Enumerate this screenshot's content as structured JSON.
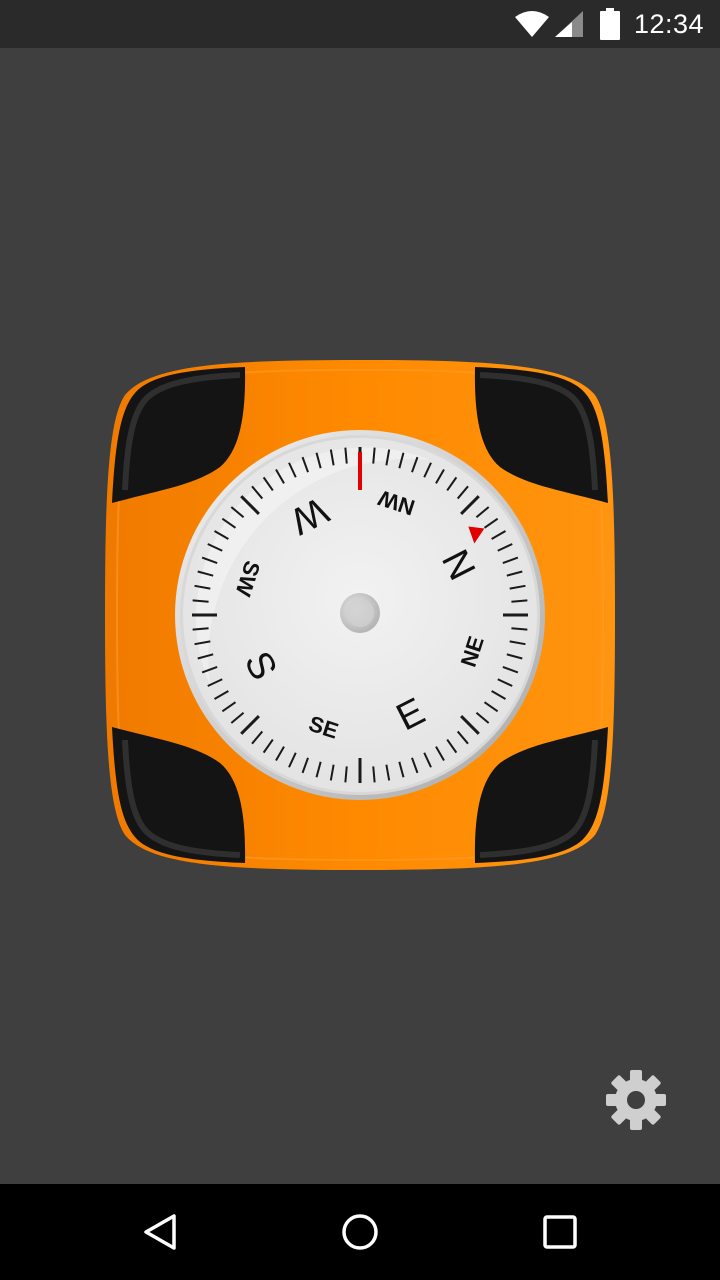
{
  "status_bar": {
    "time": "12:34",
    "icons": [
      "wifi-icon",
      "signal-icon",
      "battery-icon"
    ]
  },
  "compass": {
    "direction_labels": [
      {
        "label": "N",
        "angle": 63
      },
      {
        "label": "NE",
        "angle": 108
      },
      {
        "label": "E",
        "angle": 153
      },
      {
        "label": "SE",
        "angle": 198
      },
      {
        "label": "S",
        "angle": 243
      },
      {
        "label": "SW",
        "angle": 288
      },
      {
        "label": "W",
        "angle": 333
      },
      {
        "label": "NW",
        "angle": 18
      }
    ],
    "colors": {
      "body": "#ff8a00",
      "bumper": "#141414",
      "dial": "#ececec",
      "bezel": "#c8c8c8",
      "tick": "#1a1a1a",
      "accent": "#e00000"
    }
  },
  "settings": {
    "icon": "gear-icon",
    "color": "#cfcfcf"
  },
  "nav_bar": {
    "buttons": [
      "back-icon",
      "home-icon",
      "recents-icon"
    ]
  }
}
